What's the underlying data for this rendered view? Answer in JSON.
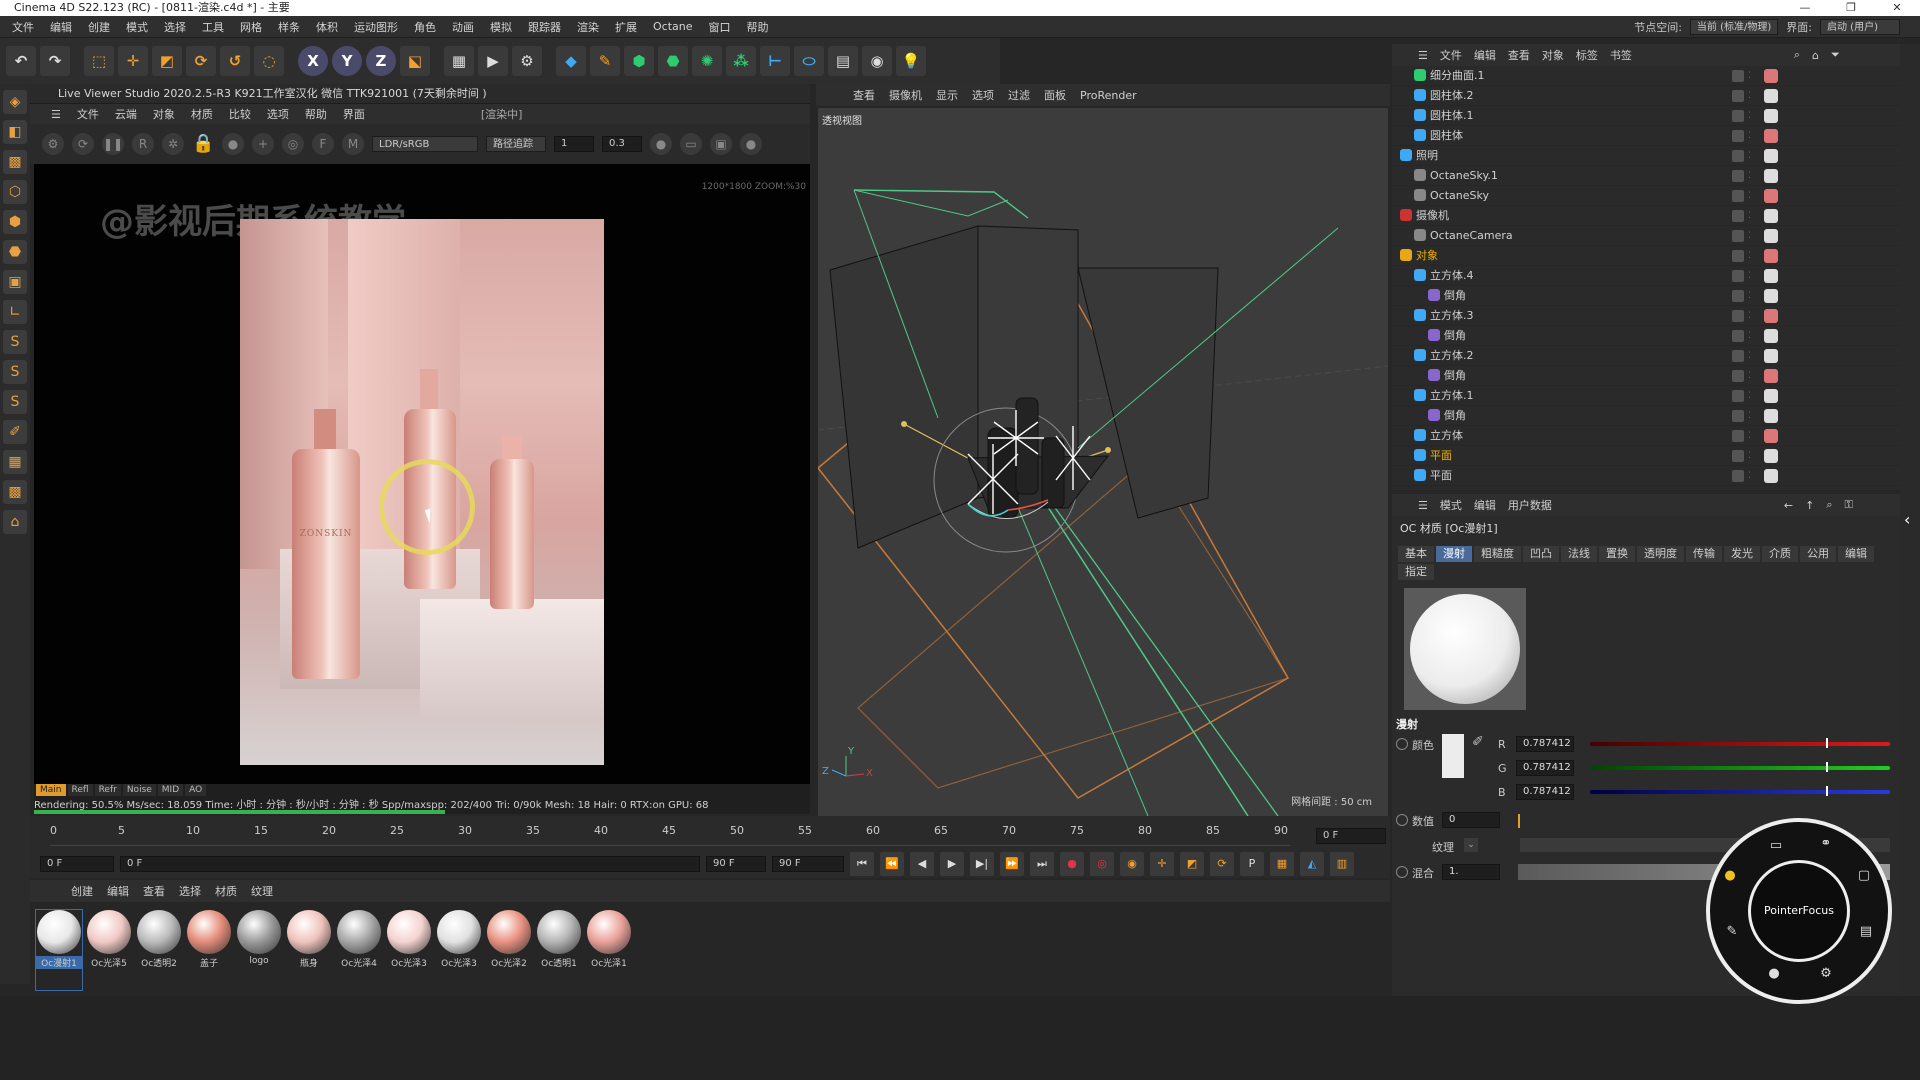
{
  "window": {
    "title": "Cinema 4D S22.123 (RC) - [0811-渲染.c4d *] - 主要",
    "controls": [
      "—",
      "❐",
      "✕"
    ]
  },
  "menubar": {
    "items": [
      "文件",
      "编辑",
      "创建",
      "模式",
      "选择",
      "工具",
      "网格",
      "样条",
      "体积",
      "运动图形",
      "角色",
      "动画",
      "模拟",
      "跟踪器",
      "渲染",
      "扩展",
      "Octane",
      "窗口",
      "帮助"
    ],
    "node_space_label": "节点空间:",
    "node_space_value": "当前 (标准/物理)",
    "layout_label": "界面:",
    "layout_value": "启动 (用户)"
  },
  "toolbar": {
    "axes": [
      "X",
      "Y",
      "Z"
    ]
  },
  "live_viewer": {
    "header": "Live Viewer Studio   2020.2.5-R3  K921工作室汉化 微信  TTK921001 (7天剩余时间 )",
    "menu": [
      "文件",
      "云端",
      "对象",
      "材质",
      "比较",
      "选项",
      "帮助",
      "界面"
    ],
    "status_badge": "[渲染中]",
    "color_space": "LDR/sRGB",
    "kernel": "路径追踪",
    "value1": "1",
    "value2": "0.3",
    "watermark": "@影视后期系统教学",
    "zoom_info": "1200*1800 ZOOM:%30",
    "tags": [
      "Main",
      "Refl",
      "Refr",
      "Noise",
      "MID",
      "AO"
    ],
    "status_line": "Rendering: 50.5%   Ms/sec: 18.059   Time: 小时 : 分钟 : 秒/小时 : 分钟 : 秒   Spp/maxspp: 202/400    Tri: 0/90k   Mesh: 18   Hair: 0   RTX:on      GPU:     68",
    "progress": 0.505,
    "brand_text": "ZONSKIN"
  },
  "viewport": {
    "menu": [
      "查看",
      "摄像机",
      "显示",
      "选项",
      "过滤",
      "面板",
      "ProRender"
    ],
    "label": "透视视图",
    "grid_info": "网格间距 : 50 cm"
  },
  "timeline": {
    "ticks": [
      "0",
      "5",
      "10",
      "15",
      "20",
      "25",
      "30",
      "35",
      "40",
      "45",
      "50",
      "55",
      "60",
      "65",
      "70",
      "75",
      "80",
      "85",
      "90"
    ],
    "current_frame": "0 F",
    "start": "0 F",
    "range_start": "0 F",
    "end": "90 F",
    "end2": "90 F",
    "right_frame": "0 F"
  },
  "materials": {
    "menu": [
      "创建",
      "编辑",
      "查看",
      "选择",
      "材质",
      "纹理"
    ],
    "items": [
      {
        "name": "Oc漫射1",
        "color": "#e8e8e8"
      },
      {
        "name": "Oc光泽5",
        "color": "#f1c9c4"
      },
      {
        "name": "Oc透明2",
        "color": "#bbbbbb"
      },
      {
        "name": "盖子",
        "color": "#e38b78"
      },
      {
        "name": "logo",
        "color": "#9a9a9a"
      },
      {
        "name": "瓶身",
        "color": "#f0c2bc"
      },
      {
        "name": "Oc光泽4",
        "color": "#a8a8a8"
      },
      {
        "name": "Oc光泽3",
        "color": "#f4d3cf"
      },
      {
        "name": "Oc光泽3",
        "color": "#e1e1e1"
      },
      {
        "name": "Oc光泽2",
        "color": "#e9907f"
      },
      {
        "name": "Oc透明1",
        "color": "#b4b4b4"
      },
      {
        "name": "Oc光泽1",
        "color": "#eaa098"
      }
    ]
  },
  "objects": {
    "menu": [
      "文件",
      "编辑",
      "查看",
      "对象",
      "标签",
      "书签"
    ],
    "rows": [
      {
        "name": "细分曲面.1",
        "indent": 1,
        "icon": "#2ecc71"
      },
      {
        "name": "圆柱体.2",
        "indent": 1,
        "icon": "#3fa9f5"
      },
      {
        "name": "圆柱体.1",
        "indent": 1,
        "icon": "#3fa9f5"
      },
      {
        "name": "圆柱体",
        "indent": 1,
        "icon": "#3fa9f5"
      },
      {
        "name": "照明",
        "indent": 0,
        "icon": "#3fa9f5"
      },
      {
        "name": "OctaneSky.1",
        "indent": 1,
        "icon": "#888888"
      },
      {
        "name": "OctaneSky",
        "indent": 1,
        "icon": "#888888"
      },
      {
        "name": "摄像机",
        "indent": 0,
        "icon": "#cc3333"
      },
      {
        "name": "OctaneCamera",
        "indent": 1,
        "icon": "#888888"
      },
      {
        "name": "对象",
        "indent": 0,
        "icon": "#e6a817",
        "highlight": true
      },
      {
        "name": "立方体.4",
        "indent": 1,
        "icon": "#3fa9f5"
      },
      {
        "name": "倒角",
        "indent": 2,
        "icon": "#8866cc"
      },
      {
        "name": "立方体.3",
        "indent": 1,
        "icon": "#3fa9f5"
      },
      {
        "name": "倒角",
        "indent": 2,
        "icon": "#8866cc"
      },
      {
        "name": "立方体.2",
        "indent": 1,
        "icon": "#3fa9f5"
      },
      {
        "name": "倒角",
        "indent": 2,
        "icon": "#8866cc"
      },
      {
        "name": "立方体.1",
        "indent": 1,
        "icon": "#3fa9f5"
      },
      {
        "name": "倒角",
        "indent": 2,
        "icon": "#8866cc"
      },
      {
        "name": "立方体",
        "indent": 1,
        "icon": "#3fa9f5"
      },
      {
        "name": "平面",
        "indent": 1,
        "icon": "#3fa9f5",
        "highlight": true
      },
      {
        "name": "平面",
        "indent": 1,
        "icon": "#3fa9f5"
      }
    ]
  },
  "attributes": {
    "menu": [
      "模式",
      "编辑",
      "用户数据"
    ],
    "title": "OC 材质 [Oc漫射1]",
    "tabs": [
      "基本",
      "漫射",
      "粗糙度",
      "凹凸",
      "法线",
      "置换",
      "透明度",
      "传输",
      "发光",
      "介质",
      "公用",
      "编辑",
      "指定"
    ],
    "active_tab": "漫射",
    "section": "漫射",
    "color_label": "颜色",
    "r_label": "R",
    "r_value": "0.787412",
    "g_label": "G",
    "g_value": "0.787412",
    "b_label": "B",
    "b_value": "0.787412",
    "float_label": "数值",
    "float_value": "0",
    "texture_label": "纹理",
    "mix_label": "混合",
    "mix_value": "1."
  },
  "pointer_wheel": {
    "label": "PointerFocus"
  }
}
